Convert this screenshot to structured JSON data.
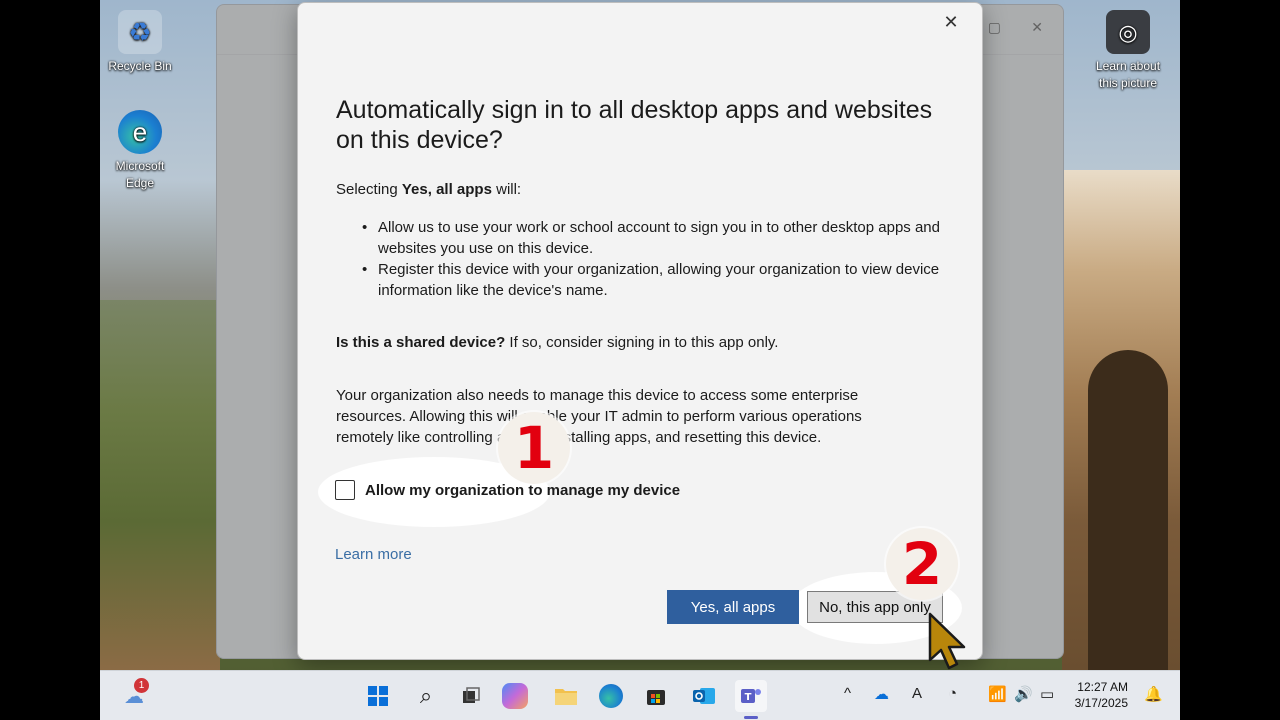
{
  "desktop": {
    "icons": [
      {
        "label": "Recycle Bin"
      },
      {
        "label": "Microsoft Edge"
      },
      {
        "label": "Learn about this picture"
      }
    ]
  },
  "dialog": {
    "title": "Automatically sign in to all desktop apps and websites on this device?",
    "intro_prefix": "Selecting ",
    "intro_bold": "Yes, all apps",
    "intro_suffix": " will:",
    "bullets": [
      "Allow us to use your work or school account to sign you in to other desktop apps and websites you use on this device.",
      "Register this device with your organization, allowing your organization to view device information like the device's name."
    ],
    "shared_bold": "Is this a shared device?",
    "shared_text": " If so, consider signing in to this app only.",
    "manage_text": "Your organization also needs to manage this device to access some enterprise resources. Allowing this will enable your IT admin to perform various operations remotely like controlling access, installing apps, and resetting this device.",
    "checkbox_label": "Allow my organization to manage my device",
    "learn_more": "Learn more",
    "yes_button": "Yes, all apps",
    "no_button": "No, this app only",
    "close_icon": "close-icon"
  },
  "annotations": {
    "step1": "1",
    "step2": "2"
  },
  "taskbar": {
    "notification_badge": "1",
    "clock_time": "12:27 AM",
    "clock_date": "3/17/2025",
    "icons": [
      "weather-icon",
      "windows-start-icon",
      "search-icon",
      "task-view-icon",
      "copilot-icon",
      "file-explorer-icon",
      "edge-icon",
      "store-icon",
      "outlook-icon",
      "teams-icon"
    ],
    "tray": [
      "chevron-up-icon",
      "onedrive-icon",
      "ime-icon",
      "focus-icon",
      "wifi-icon",
      "volume-icon",
      "battery-icon",
      "bell-icon"
    ]
  },
  "colors": {
    "primary_button": "#2f5f9e",
    "link": "#3a6ea5",
    "annotation_red": "#e2000f"
  }
}
